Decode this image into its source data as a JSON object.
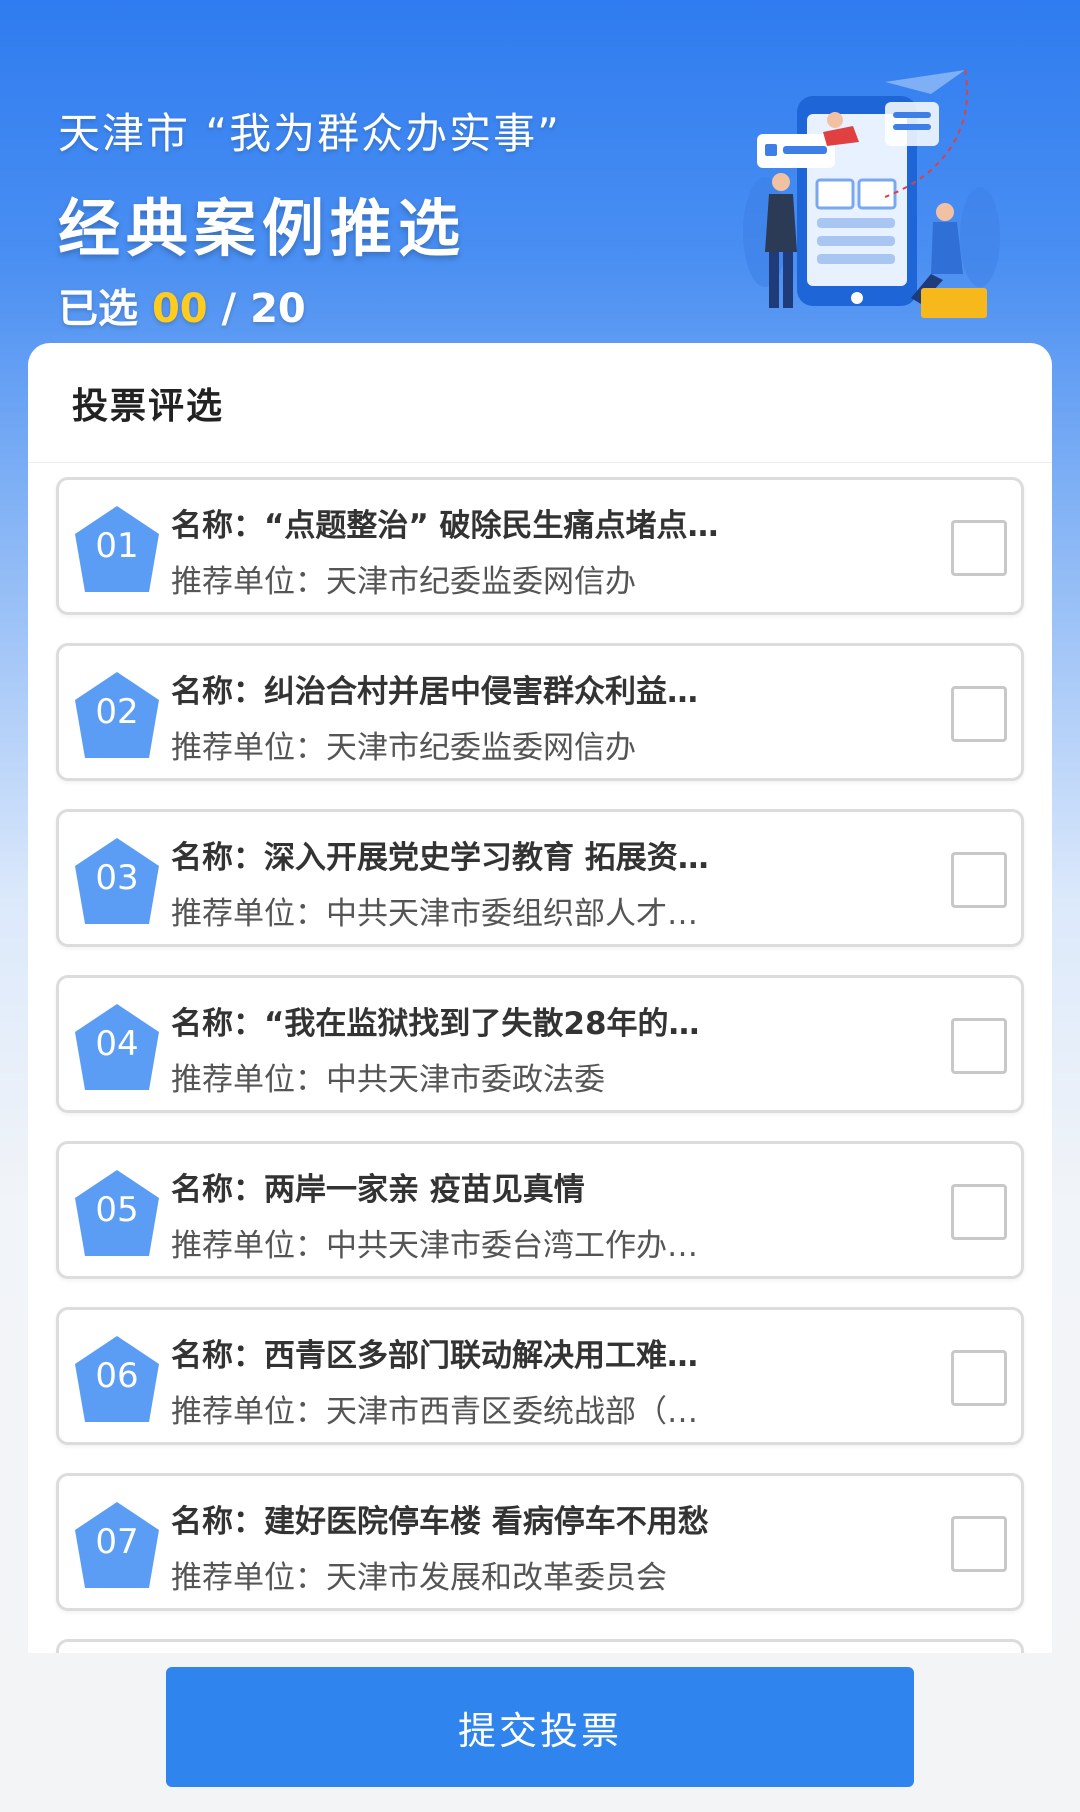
{
  "header": {
    "sub_title": "天津市 “我为群众办实事”",
    "main_title": "经典案例推选",
    "selected_label": "已选 ",
    "selected_count": "00",
    "separator": " / ",
    "total_count": "20"
  },
  "panel": {
    "title": "投票评选"
  },
  "items": [
    {
      "num": "01",
      "name": "名称：“点题整治” 破除民生痛点堵点…",
      "unit": "推荐单位：天津市纪委监委网信办"
    },
    {
      "num": "02",
      "name": "名称：纠治合村并居中侵害群众利益…",
      "unit": "推荐单位：天津市纪委监委网信办"
    },
    {
      "num": "03",
      "name": "名称：深入开展党史学习教育 拓展资…",
      "unit": "推荐单位：中共天津市委组织部人才…"
    },
    {
      "num": "04",
      "name": "名称：“我在监狱找到了失散28年的…",
      "unit": "推荐单位：中共天津市委政法委"
    },
    {
      "num": "05",
      "name": "名称：两岸一家亲 疫苗见真情",
      "unit": "推荐单位：中共天津市委台湾工作办…"
    },
    {
      "num": "06",
      "name": "名称：西青区多部门联动解决用工难…",
      "unit": "推荐单位：天津市西青区委统战部（…"
    },
    {
      "num": "07",
      "name": "名称：建好医院停车楼 看病停车不用愁",
      "unit": "推荐单位：天津市发展和改革委员会"
    }
  ],
  "footer": {
    "submit_label": "提交投票"
  },
  "colors": {
    "accent": "#2f84ee",
    "badge": "#5b9df5",
    "highlight": "#ffcc1e"
  }
}
